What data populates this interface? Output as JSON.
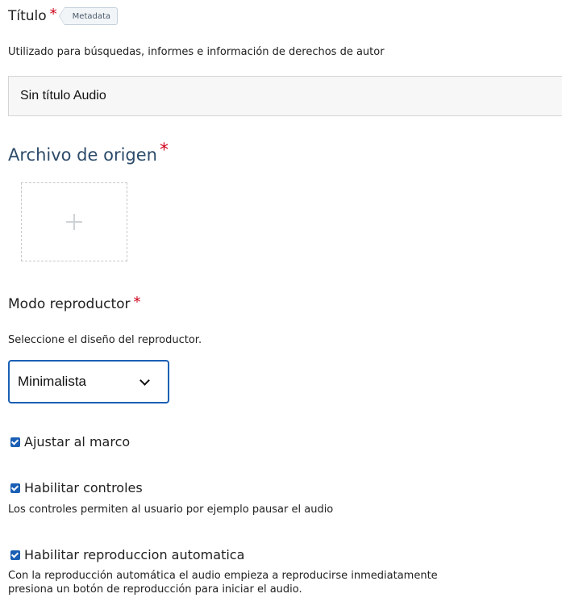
{
  "title_field": {
    "label": "Título",
    "required_mark": "*",
    "metadata_tag": "Metadata",
    "description": "Utilizado para búsquedas, informes e información de derechos de autor",
    "value": "Sin título Audio"
  },
  "source_file": {
    "label": "Archivo de origen",
    "required_mark": "*"
  },
  "player_mode": {
    "label": "Modo reproductor",
    "required_mark": "*",
    "description": "Seleccione el diseño del reproductor.",
    "selected": "Minimalista"
  },
  "options": {
    "fit_to_frame": {
      "label": "Ajustar al marco",
      "checked": true
    },
    "enable_controls": {
      "label": "Habilitar controles",
      "checked": true,
      "description": "Los controles permiten al usuario por ejemplo pausar el audio"
    },
    "autoplay": {
      "label": "Habilitar reproduccion automatica",
      "checked": true,
      "description_line1": "Con la reproducción automática el audio empieza a reproducirse inmediatamente",
      "description_line2": "presiona un botón de reproducción para iniciar el audio."
    }
  },
  "colors": {
    "accent": "#1a5fb4",
    "required": "#d0021b",
    "section_title": "#2c4b6a"
  }
}
